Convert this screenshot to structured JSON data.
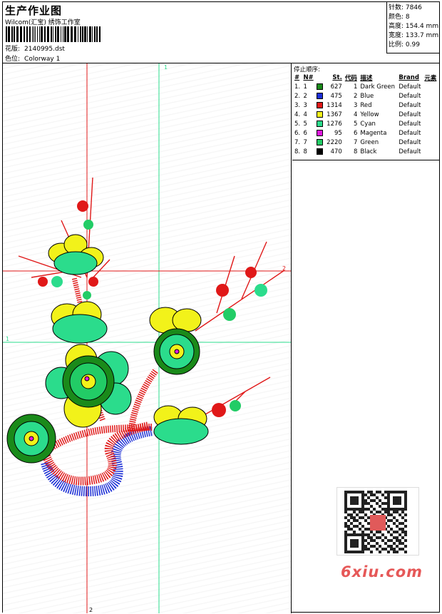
{
  "header": {
    "title": "生产作业图",
    "company": "Wilcom(汇宝) 绣饰工作室",
    "design_label": "花版:",
    "design_file": "2140995.dst",
    "colorway_label": "色位:",
    "colorway": "Colorway 1"
  },
  "specs": [
    {
      "label": "针数:",
      "value": "7846"
    },
    {
      "label": "颜色:",
      "value": "8"
    },
    {
      "label": "高度:",
      "value": "154.4 mm"
    },
    {
      "label": "宽度:",
      "value": "133.7 mm"
    },
    {
      "label": "比例:",
      "value": "0.99"
    }
  ],
  "guides": {
    "v_red": "2",
    "v_green": "1",
    "h_red": "2",
    "h_green": "1",
    "v_red_bottom": "2"
  },
  "stop_sequence": {
    "title": "停止顺序:",
    "headers": [
      "#",
      "N#",
      "St.",
      "代码",
      "描述",
      "Brand",
      "元素"
    ],
    "rows": [
      {
        "idx": "1.",
        "n": "1",
        "color": "#1a8a1a",
        "st": "627",
        "code": "1",
        "desc": "Dark Green",
        "brand": "Default"
      },
      {
        "idx": "2.",
        "n": "2",
        "color": "#1c2fd6",
        "st": "475",
        "code": "2",
        "desc": "Blue",
        "brand": "Default"
      },
      {
        "idx": "3.",
        "n": "3",
        "color": "#e01818",
        "st": "1314",
        "code": "3",
        "desc": "Red",
        "brand": "Default"
      },
      {
        "idx": "4.",
        "n": "4",
        "color": "#f2f21a",
        "st": "1367",
        "code": "4",
        "desc": "Yellow",
        "brand": "Default"
      },
      {
        "idx": "5.",
        "n": "5",
        "color": "#2bdc8c",
        "st": "1276",
        "code": "5",
        "desc": "Cyan",
        "brand": "Default"
      },
      {
        "idx": "6.",
        "n": "6",
        "color": "#e01ae0",
        "st": "95",
        "code": "6",
        "desc": "Magenta",
        "brand": "Default"
      },
      {
        "idx": "7.",
        "n": "7",
        "color": "#22cc66",
        "st": "2220",
        "code": "7",
        "desc": "Green",
        "brand": "Default"
      },
      {
        "idx": "8.",
        "n": "8",
        "color": "#000000",
        "st": "470",
        "code": "8",
        "desc": "Black",
        "brand": "Default"
      }
    ]
  },
  "watermark": "6xiu.com"
}
